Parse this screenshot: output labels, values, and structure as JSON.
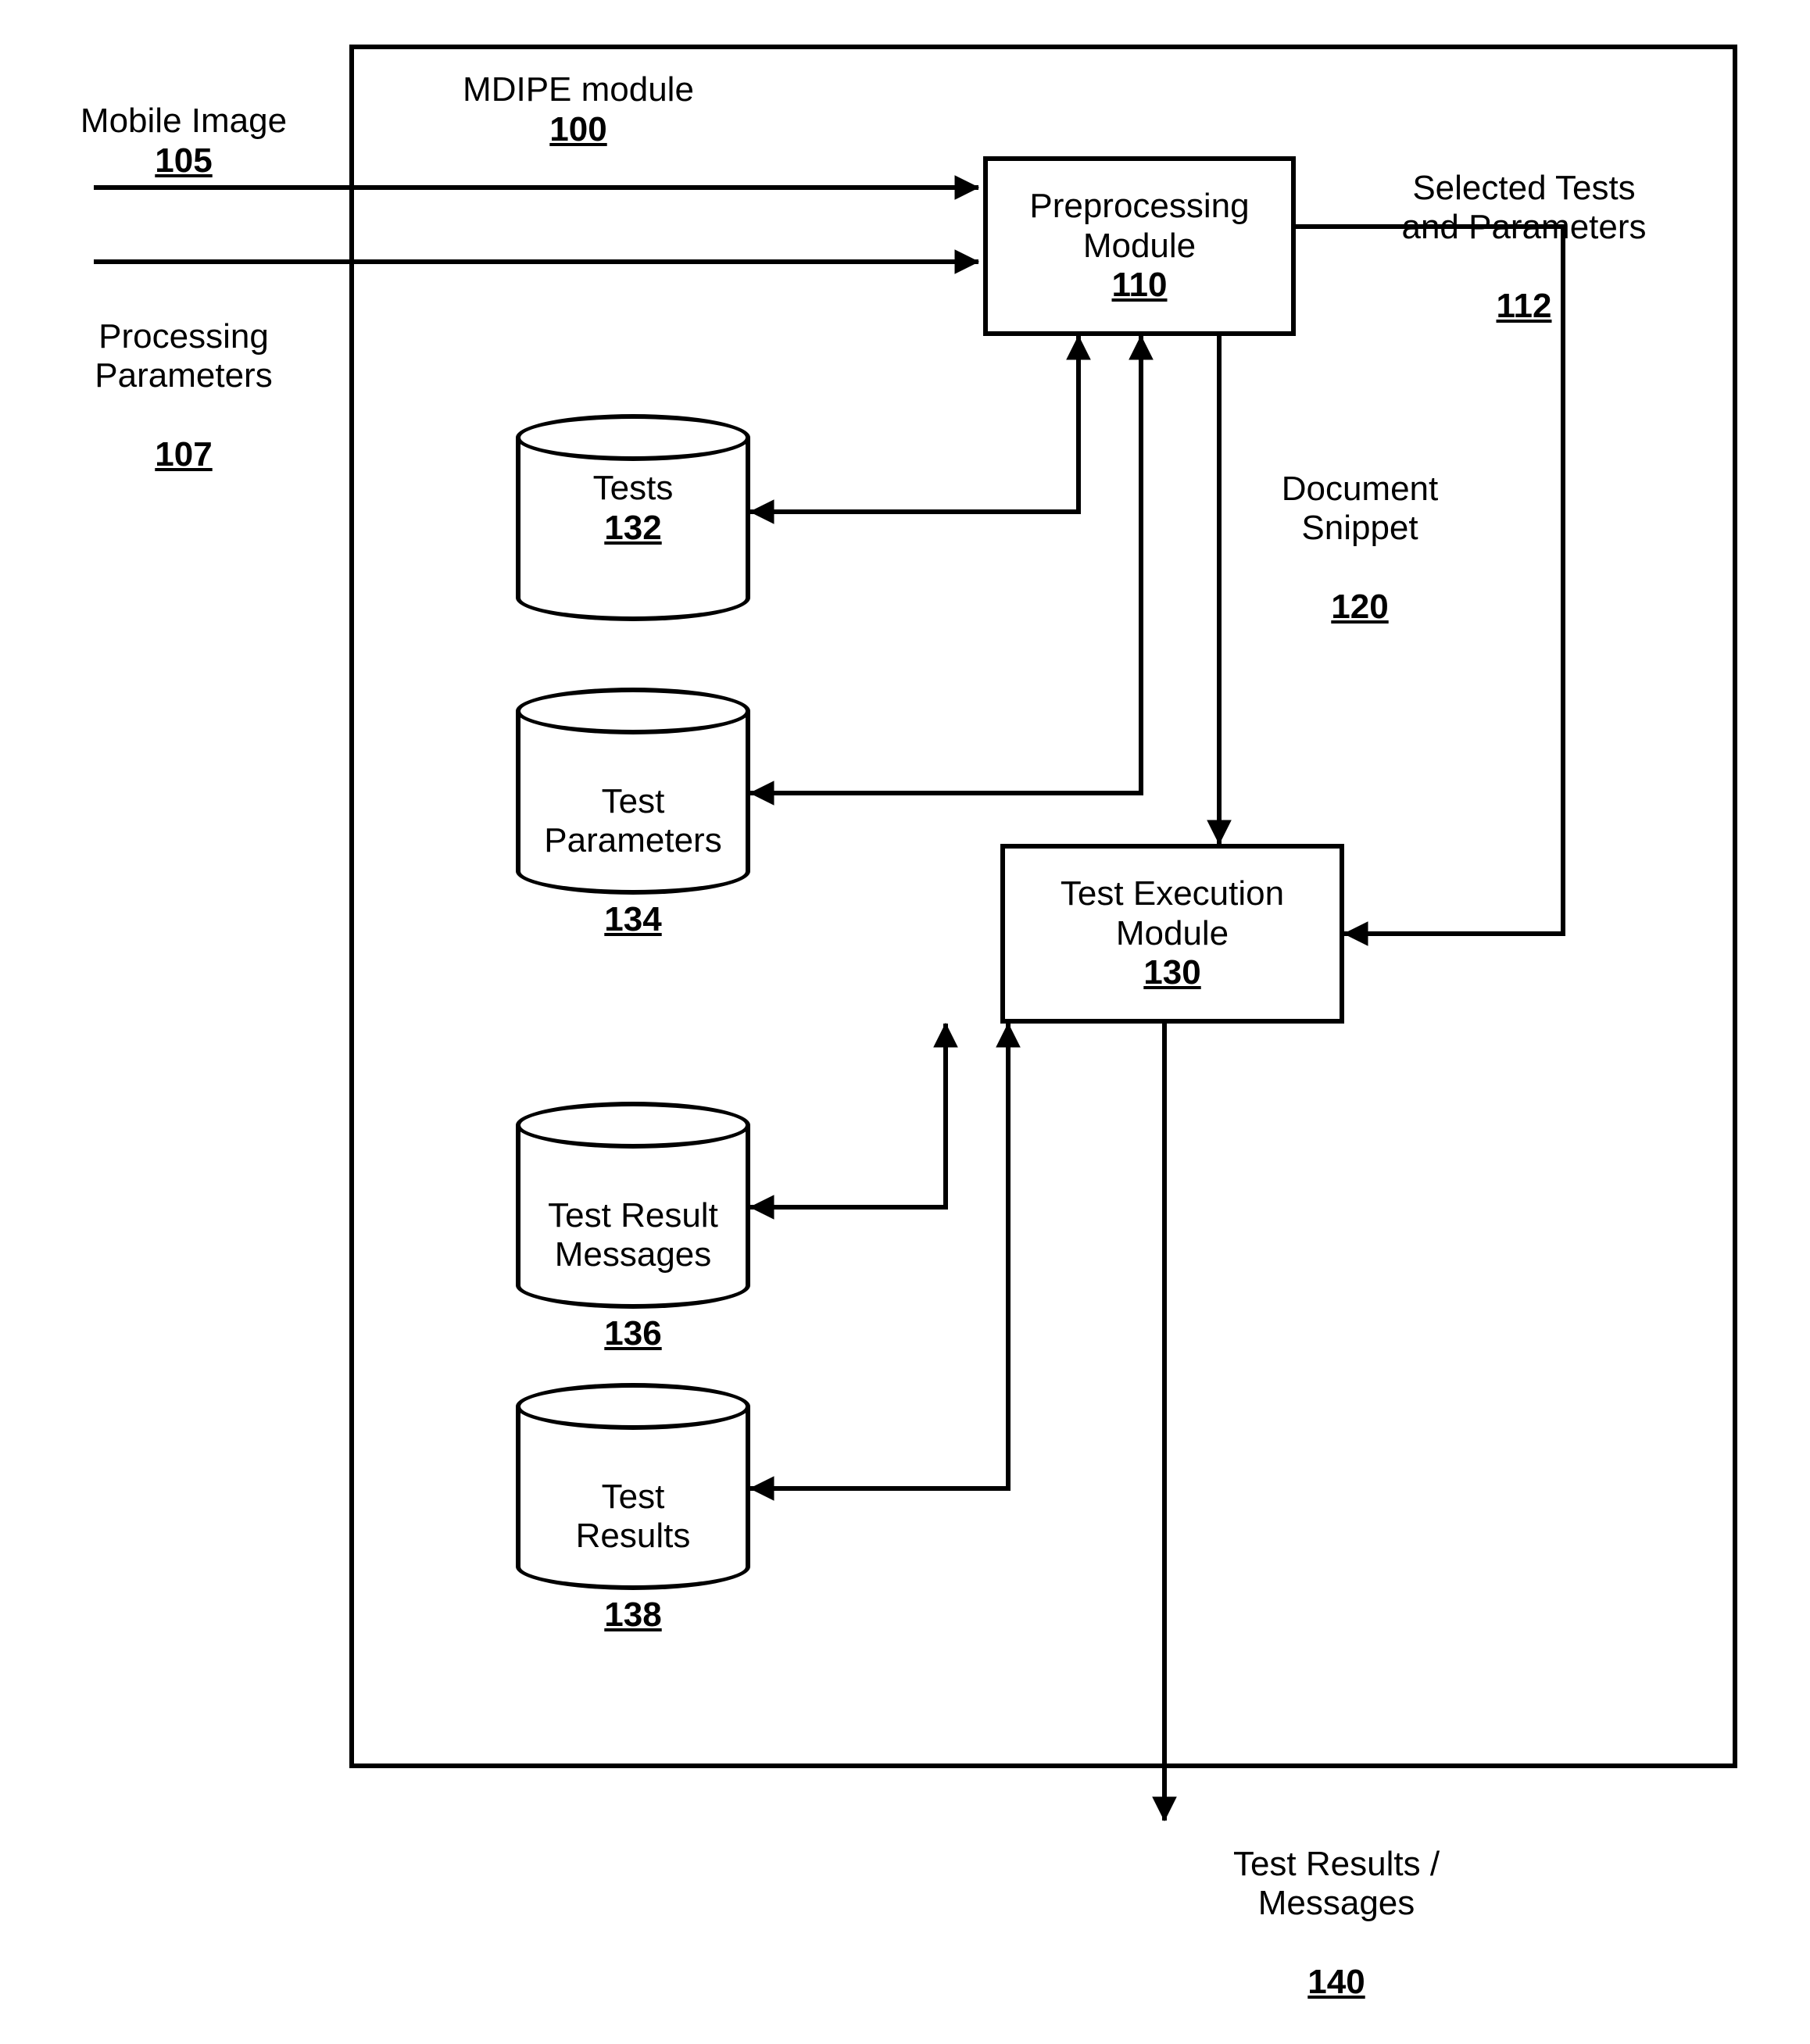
{
  "module_title": {
    "name": "MDIPE module",
    "ref": "100"
  },
  "inputs": {
    "mobile_image": {
      "name": "Mobile Image",
      "ref": "105"
    },
    "processing_params": {
      "name": "Processing\nParameters",
      "ref": "107"
    }
  },
  "outputs": {
    "selected": {
      "name": "Selected Tests\nand Parameters",
      "ref": "112"
    },
    "snippet": {
      "name": "Document\nSnippet",
      "ref": "120"
    },
    "results": {
      "name": "Test Results /\nMessages",
      "ref": "140"
    }
  },
  "boxes": {
    "preprocessing": {
      "name": "Preprocessing\nModule",
      "ref": "110"
    },
    "test_execution": {
      "name": "Test Execution\nModule",
      "ref": "130"
    }
  },
  "datastores": {
    "tests": {
      "name": "Tests",
      "ref": "132"
    },
    "test_params": {
      "name": "Test\nParameters",
      "ref": "134"
    },
    "test_msgs": {
      "name": "Test Result\nMessages",
      "ref": "136"
    },
    "test_results": {
      "name": "Test\nResults",
      "ref": "138"
    }
  }
}
